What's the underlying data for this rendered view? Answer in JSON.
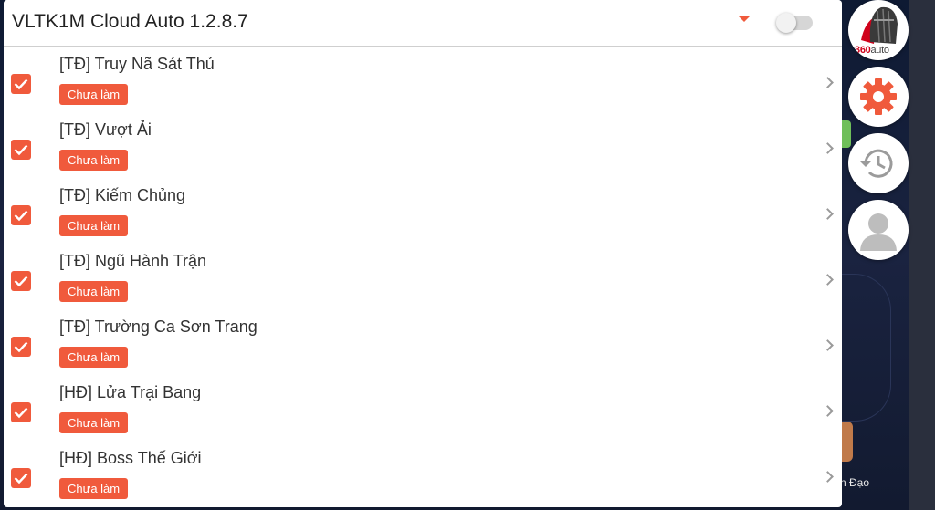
{
  "app": {
    "title": "VLTK1M Cloud Auto 1.2.8.7",
    "enabled": false
  },
  "tasks": [
    {
      "name": "[TĐ] Truy Nã Sát Thủ",
      "status": "Chưa làm",
      "checked": true
    },
    {
      "name": "[TĐ] Vượt Ải",
      "status": "Chưa làm",
      "checked": true
    },
    {
      "name": "[TĐ] Kiếm Chủng",
      "status": "Chưa làm",
      "checked": true
    },
    {
      "name": "[TĐ] Ngũ Hành Trận",
      "status": "Chưa làm",
      "checked": true
    },
    {
      "name": "[TĐ] Trường Ca Sơn Trang",
      "status": "Chưa làm",
      "checked": true
    },
    {
      "name": "[HĐ] Lửa Trại Bang",
      "status": "Chưa làm",
      "checked": true
    },
    {
      "name": "[HĐ] Boss Thế Giới",
      "status": "Chưa làm",
      "checked": true
    }
  ],
  "side_buttons": {
    "logo_text_brand": "360",
    "logo_text_suffix": "auto",
    "icons": [
      "helmet-logo-icon",
      "gear-icon",
      "history-icon",
      "user-icon"
    ]
  },
  "background": {
    "partial_label": "n Đạo"
  },
  "colors": {
    "accent": "#f05a3c",
    "chevron": "#9a9a9a"
  }
}
